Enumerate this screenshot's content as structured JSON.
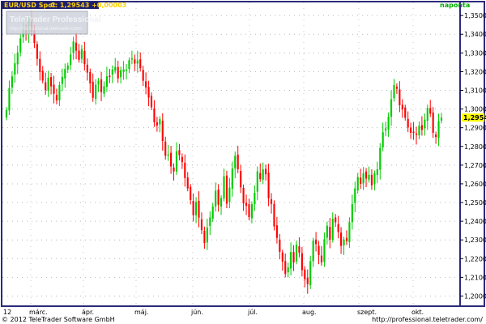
{
  "header": {
    "instrument": "EUR/USD Spot",
    "quote": "C: 1,29543 +0,00003",
    "period": "naponta"
  },
  "watermark": {
    "brand": "TeleTrader Professional",
    "url": "http://professional.teletrader.com/"
  },
  "footer": {
    "copyright": "© 2012 TeleTrader Software GmbH",
    "url": "http://professional.teletrader.com/"
  },
  "colors": {
    "up": "#00cc00",
    "down": "#ff0000",
    "frame": "#2b2b7a",
    "header_bg": "#1f1f6e",
    "header_text": "#ffd200",
    "period_text": "#00dd00",
    "last_price_bg": "#ffff00"
  },
  "chart_data": {
    "type": "candlestick",
    "title": "EUR/USD Spot",
    "y_ticks": [
      "1,35000",
      "1,34000",
      "1,33000",
      "1,32000",
      "1,31000",
      "1,30000",
      "1,29000",
      "1,28000",
      "1,27000",
      "1,26000",
      "1,25000",
      "1,24000",
      "1,23000",
      "1,22000",
      "1,21000",
      "1,20000"
    ],
    "ylim": [
      1.195,
      1.357
    ],
    "x_ticks": [
      "12",
      "márc.",
      "ápr.",
      "máj.",
      "jún.",
      "júl.",
      "aug.",
      "szept.",
      "okt."
    ],
    "last_price": 1.29543,
    "last_price_label": "1,29543",
    "grid": true,
    "closes": [
      1.2995,
      1.3112,
      1.3175,
      1.3245,
      1.3302,
      1.3378,
      1.343,
      1.3405,
      1.3478,
      1.3411,
      1.3353,
      1.3268,
      1.3198,
      1.3152,
      1.3101,
      1.3168,
      1.3121,
      1.3082,
      1.3046,
      1.3128,
      1.3172,
      1.3214,
      1.3233,
      1.3291,
      1.3361,
      1.3312,
      1.3263,
      1.332,
      1.324,
      1.3195,
      1.3137,
      1.306,
      1.313,
      1.3152,
      1.3091,
      1.3122,
      1.3175,
      1.3175,
      1.3211,
      1.3225,
      1.3164,
      1.3208,
      1.3213,
      1.3211,
      1.3261,
      1.3271,
      1.3243,
      1.326,
      1.3218,
      1.3151,
      1.3115,
      1.3061,
      1.3009,
      1.2929,
      1.2912,
      1.2946,
      1.2829,
      1.275,
      1.2757,
      1.2693,
      1.2666,
      1.2774,
      1.2753,
      1.2716,
      1.2631,
      1.2575,
      1.2514,
      1.2432,
      1.2503,
      1.2419,
      1.2352,
      1.2283,
      1.2366,
      1.242,
      1.2479,
      1.2563,
      1.2488,
      1.2524,
      1.2641,
      1.2494,
      1.258,
      1.2682,
      1.275,
      1.2678,
      1.2581,
      1.2495,
      1.2482,
      1.2422,
      1.2491,
      1.2552,
      1.2667,
      1.2625,
      1.2677,
      1.2651,
      1.2523,
      1.2493,
      1.2372,
      1.2311,
      1.2236,
      1.2184,
      1.2118,
      1.2153,
      1.2235,
      1.2179,
      1.2275,
      1.2232,
      1.2138,
      1.2089,
      1.2064,
      1.2186,
      1.2296,
      1.2278,
      1.2219,
      1.218,
      1.2303,
      1.2376,
      1.2301,
      1.2414,
      1.2394,
      1.2342,
      1.2268,
      1.2302,
      1.2294,
      1.2395,
      1.2491,
      1.2575,
      1.2636,
      1.26,
      1.2657,
      1.2628,
      1.2648,
      1.2592,
      1.2656,
      1.2678,
      1.2792,
      1.2876,
      1.2896,
      1.2959,
      1.3052,
      1.3128,
      1.3108,
      1.302,
      1.2999,
      1.2953,
      1.2901,
      1.2873,
      1.2878,
      1.2862,
      1.2911,
      1.2888,
      1.2943,
      1.3005,
      1.2975,
      1.2873,
      1.285,
      1.2935,
      1.2954
    ]
  }
}
